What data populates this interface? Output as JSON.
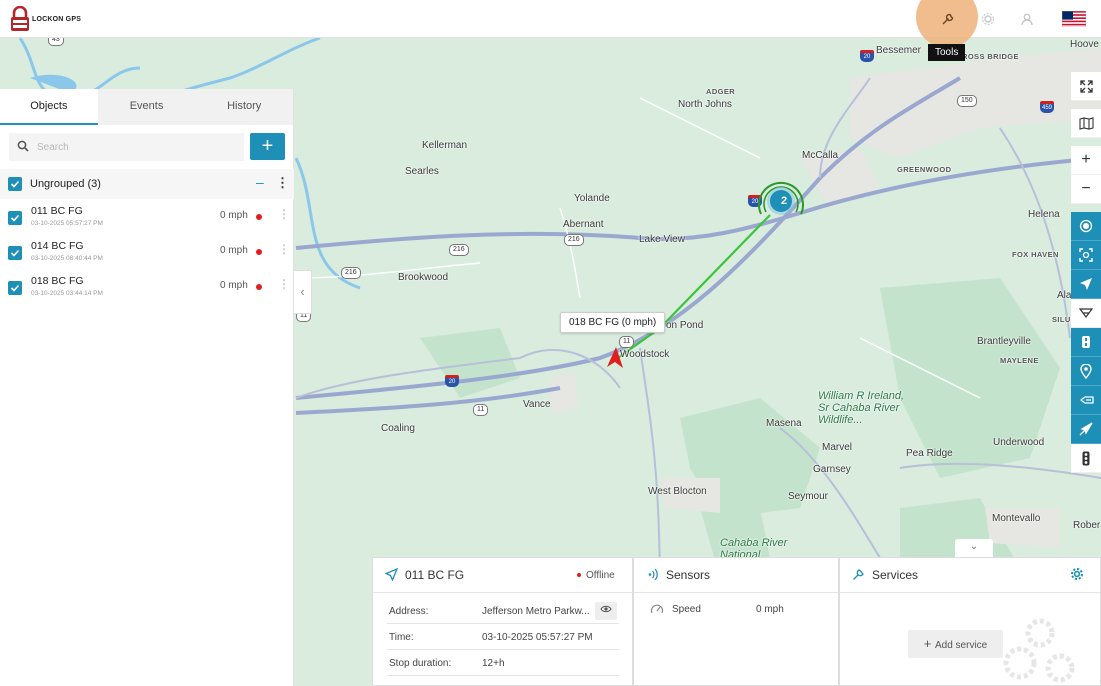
{
  "brand": {
    "logo_text": "LOCKON GPS"
  },
  "topbar": {
    "tools_tooltip": "Tools",
    "icons": [
      "wrench-icon",
      "gear-icon",
      "user-icon",
      "us-flag-icon"
    ]
  },
  "tabs": [
    {
      "label": "Objects",
      "active": true
    },
    {
      "label": "Events",
      "active": false
    },
    {
      "label": "History",
      "active": false
    }
  ],
  "search": {
    "placeholder": "Search",
    "value": "",
    "add_label": "+"
  },
  "group": {
    "label": "Ungrouped (3)",
    "collapse": "–",
    "menu": "⋮"
  },
  "objects": [
    {
      "name": "011 BC FG",
      "time": "03-10-2025 05:57:27 PM",
      "speed": "0 mph",
      "status_color": "#e02020"
    },
    {
      "name": "014 BC FG",
      "time": "03-10-2025 08:40:44 PM",
      "speed": "0 mph",
      "status_color": "#e02020"
    },
    {
      "name": "018 BC FG",
      "time": "03-10-2025 03:44:14 PM",
      "speed": "0 mph",
      "status_color": "#e02020"
    }
  ],
  "map": {
    "places": [
      "Bessemer",
      "ROSS BRIDGE",
      "Hoove",
      "ADGER",
      "North Johns",
      "Kellerman",
      "Searles",
      "McCalla",
      "GREENWOOD",
      "Helena",
      "Yolande",
      "Abernant",
      "Lake View",
      "FOX HAVEN",
      "Brookwood",
      "Ala",
      "SILU",
      "Brantleyville",
      "MAYLENE",
      "Woodstock",
      "on Pond",
      "Vance",
      "Coaling",
      "Masena",
      "Marvel",
      "Underwood",
      "Pea Ridge",
      "Garnsey",
      "Seymour",
      "West Blocton",
      "Montevallo",
      "Rober"
    ],
    "park_label": "William R Ireland, Sr Cahaba River Wildlife...",
    "river_label": "Cahaba River National",
    "shields": [
      "43",
      "150",
      "216",
      "216",
      "216",
      "11",
      "11",
      "11"
    ],
    "interstates": [
      "20",
      "20",
      "20",
      "459"
    ],
    "cluster_count": "2",
    "vehicle_tooltip": "018 BC FG (0 mph)"
  },
  "right_tools": [
    "fullscreen-icon",
    "map-layers-icon",
    "zoom-in-icon",
    "zoom-out-icon",
    "target-icon",
    "fit-bounds-icon",
    "navigate-icon",
    "filter-icon",
    "street-view-icon",
    "marker-icon",
    "route-icon",
    "send-icon",
    "traffic-icon"
  ],
  "info": {
    "object_name": "011 BC FG",
    "status": "Offline",
    "rows": [
      {
        "key": "Address:",
        "value": "Jefferson Metro Parkw..."
      },
      {
        "key": "Time:",
        "value": "03-10-2025 05:57:27 PM"
      },
      {
        "key": "Stop duration:",
        "value": "12+h"
      }
    ]
  },
  "sensors": {
    "title": "Sensors",
    "rows": [
      {
        "name": "Speed",
        "value": "0 mph"
      }
    ]
  },
  "services": {
    "title": "Services",
    "add_label": "Add service"
  },
  "colors": {
    "accent": "#1e8fb7",
    "offline": "#e02020",
    "route": "#3cc43c",
    "marker": "#e02020"
  }
}
